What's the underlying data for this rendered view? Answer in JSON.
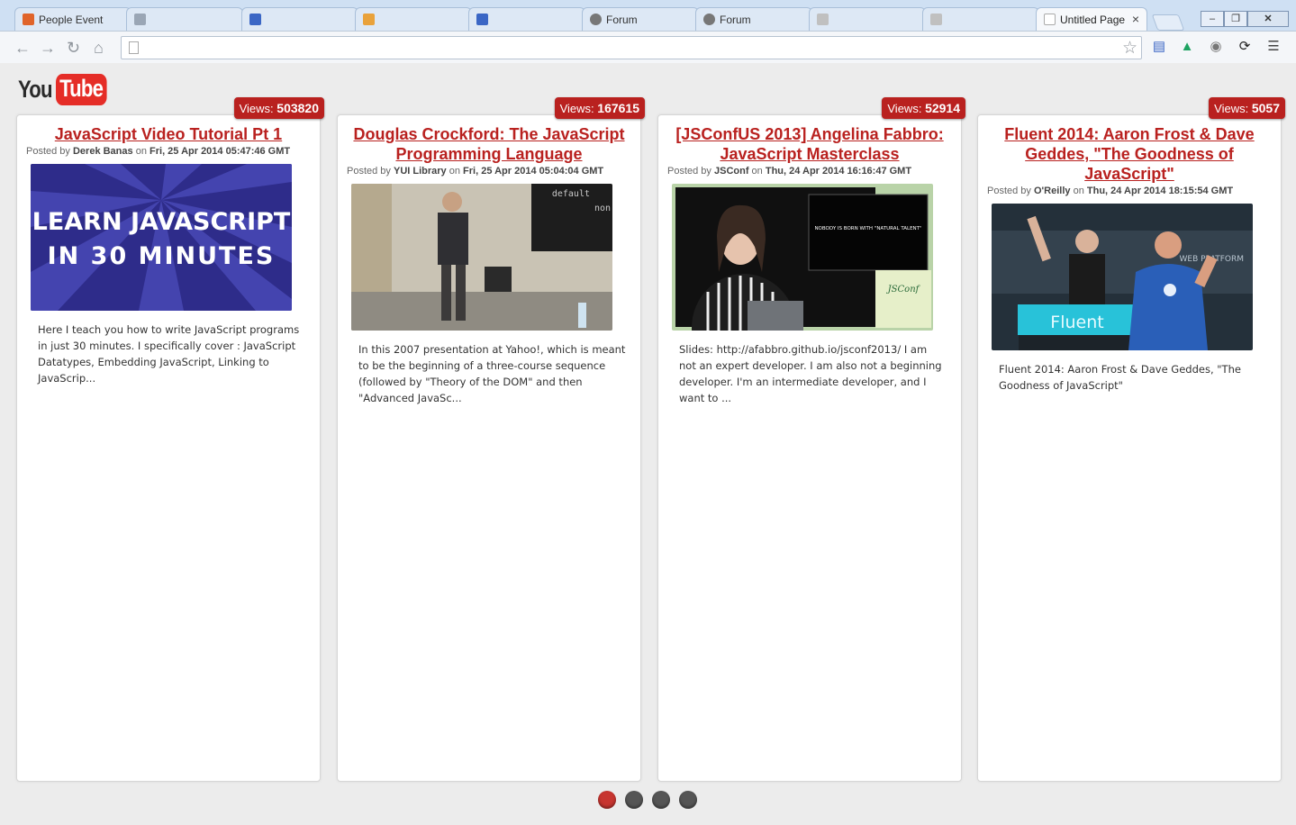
{
  "browser": {
    "tabs": [
      {
        "label": "People Event",
        "favicon_color": "#e0642a"
      },
      {
        "label": "",
        "favicon_color": "#9aa6b5"
      },
      {
        "label": "",
        "favicon_color": "#3a66c5"
      },
      {
        "label": "",
        "favicon_color": "#e9a23b"
      },
      {
        "label": "",
        "favicon_color": "#3a66c5"
      },
      {
        "label": "Forum",
        "favicon_color": "#777777"
      },
      {
        "label": "Forum",
        "favicon_color": "#777777"
      },
      {
        "label": "",
        "favicon_color": "#c0c0c0"
      },
      {
        "label": "",
        "favicon_color": "#c0c0c0"
      },
      {
        "label": "Untitled Page",
        "favicon_color": "#ffffff"
      }
    ],
    "active_tab_close": "×",
    "address_value": "",
    "window_buttons": {
      "minimize": "‒",
      "maximize": "❐",
      "close": "✕"
    }
  },
  "page": {
    "logo": {
      "you": "You",
      "tube": "Tube"
    },
    "videos": [
      {
        "views_label": "Views:",
        "views": "503820",
        "title": "JavaScript Video Tutorial Pt 1",
        "posted_by_label": "Posted by",
        "author": "Derek Banas",
        "on_label": "on",
        "date": "Fri, 25 Apr 2014 05:47:46 GMT",
        "thumb_text_line1": "LEARN JAVASCRIPT",
        "thumb_text_line2": "IN 30 MINUTES",
        "description": "Here I teach you how to write JavaScript programs in just 30 minutes. I specifically cover : JavaScript Datatypes, Embedding JavaScript, Linking to JavaScrip..."
      },
      {
        "views_label": "Views:",
        "views": "167615",
        "title": "Douglas Crockford: The JavaScript Programming Language",
        "posted_by_label": "Posted by",
        "author": "YUI Library",
        "on_label": "on",
        "date": "Fri, 25 Apr 2014 05:04:04 GMT",
        "thumb_text_line1": "default",
        "thumb_text_line2": "non",
        "description": "In this 2007 presentation at Yahoo!, which is meant to be the beginning of a three-course sequence (followed by \"Theory of the DOM\" and then \"Advanced JavaSc..."
      },
      {
        "views_label": "Views:",
        "views": "52914",
        "title": "[JSConfUS 2013] Angelina Fabbro: JavaScript Masterclass",
        "posted_by_label": "Posted by",
        "author": "JSConf",
        "on_label": "on",
        "date": "Thu, 24 Apr 2014 16:16:47 GMT",
        "thumb_text_line1": "NOBODY IS BORN WITH \"NATURAL TALENT\"",
        "thumb_text_line2": "JSConf",
        "description": "Slides: http://afabbro.github.io/jsconf2013/ I am not an expert developer. I am also not a beginning developer. I'm an intermediate developer, and I want to ..."
      },
      {
        "views_label": "Views:",
        "views": "5057",
        "title": "Fluent 2014: Aaron Frost & Dave Geddes, \"The Goodness of JavaScript\"",
        "posted_by_label": "Posted by",
        "author": "O'Reilly",
        "on_label": "on",
        "date": "Thu, 24 Apr 2014 18:15:54 GMT",
        "thumb_text_line1": "Fluent",
        "thumb_text_line2": "WEB PLATFORM",
        "description": "Fluent 2014: Aaron Frost & Dave Geddes, \"The Goodness of JavaScript\""
      }
    ],
    "pagination": {
      "active_index": 0,
      "count": 4
    }
  },
  "colors": {
    "accent": "#b9211f",
    "youtube_red": "#e52d27",
    "page_bg": "#ececec"
  }
}
